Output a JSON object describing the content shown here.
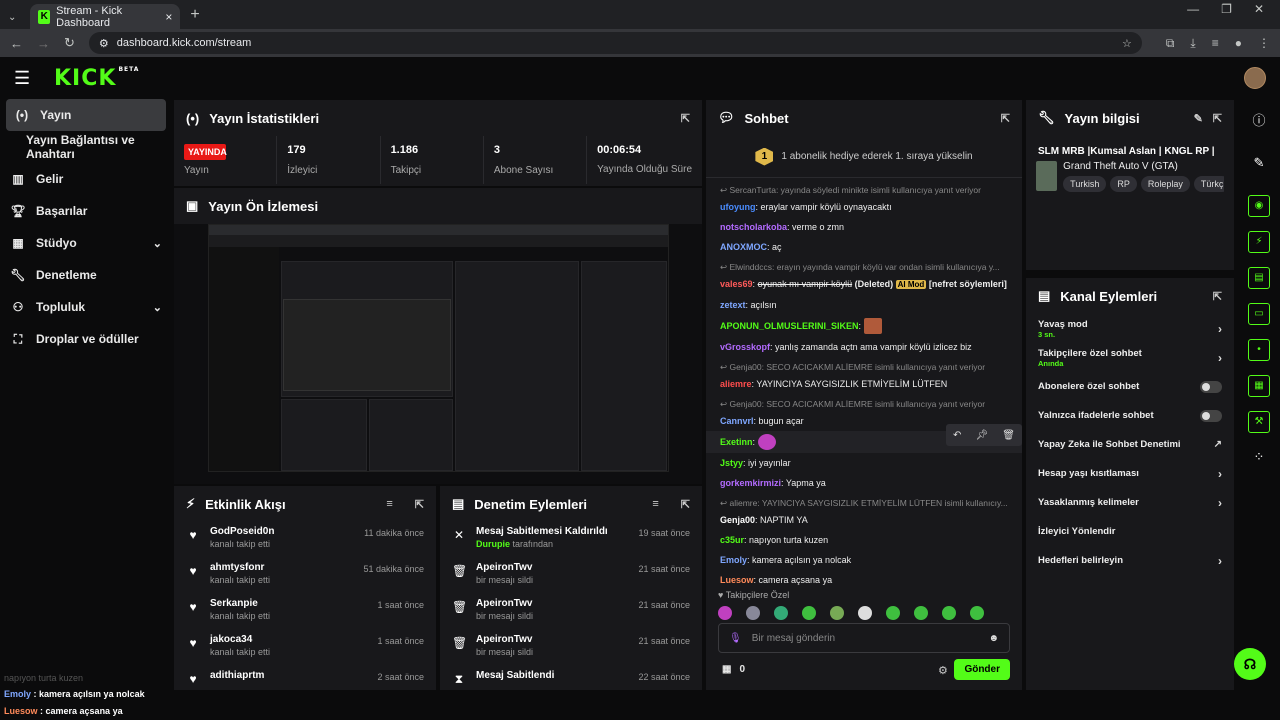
{
  "browser": {
    "tab_title": "Stream - Kick Dashboard",
    "url": "dashboard.kick.com/stream"
  },
  "brand": {
    "logo": "KICK",
    "beta": "BETA",
    "accent": "#53fc18"
  },
  "sidebar": {
    "items": [
      {
        "label": "Yayın",
        "icon": "broadcast-icon"
      },
      {
        "label": "Yayın Bağlantısı ve Anahtarı"
      },
      {
        "label": "Gelir",
        "icon": "chart-icon"
      },
      {
        "label": "Başarılar",
        "icon": "trophy-icon"
      },
      {
        "label": "Stüdyo",
        "icon": "studio-icon"
      },
      {
        "label": "Denetleme",
        "icon": "wrench-icon"
      },
      {
        "label": "Topluluk",
        "icon": "community-icon"
      },
      {
        "label": "Droplar ve ödüller",
        "icon": "gift-icon"
      }
    ]
  },
  "stats_panel": {
    "title": "Yayın İstatistikleri",
    "live_label": "YAYINDA",
    "live_caption": "Yayın",
    "stats": [
      {
        "value": "179",
        "label": "İzleyici"
      },
      {
        "value": "1.186",
        "label": "Takipçi"
      },
      {
        "value": "3",
        "label": "Abone Sayısı"
      },
      {
        "value": "00:06:54",
        "label": "Yayında Olduğu Süre"
      }
    ]
  },
  "preview_panel": {
    "title": "Yayın Ön İzlemesi"
  },
  "activity_panel": {
    "title": "Etkinlik Akışı",
    "items": [
      {
        "name": "GodPoseid0n",
        "sub": "kanalı takip etti",
        "time": "11 dakika önce"
      },
      {
        "name": "ahmtysfonr",
        "sub": "kanalı takip etti",
        "time": "51 dakika önce"
      },
      {
        "name": "Serkanpie",
        "sub": "kanalı takip etti",
        "time": "1 saat önce"
      },
      {
        "name": "jakoca34",
        "sub": "kanalı takip etti",
        "time": "1 saat önce"
      },
      {
        "name": "adithiaprtm",
        "sub": "",
        "time": "2 saat önce"
      }
    ]
  },
  "mod_panel": {
    "title": "Denetim Eylemleri",
    "items": [
      {
        "name": "Mesaj Sabitlemesi Kaldırıldı",
        "by": "Durupie",
        "sub": "tarafından",
        "time": "19 saat önce"
      },
      {
        "name": "ApeironTwv",
        "sub": "bir mesajı sildi",
        "time": "21 saat önce"
      },
      {
        "name": "ApeironTwv",
        "sub": "bir mesajı sildi",
        "time": "21 saat önce"
      },
      {
        "name": "ApeironTwv",
        "sub": "bir mesajı sildi",
        "time": "21 saat önce"
      },
      {
        "name": "Mesaj Sabitlendi",
        "sub": "",
        "time": "22 saat önce"
      }
    ]
  },
  "chat": {
    "title": "Sohbet",
    "banner": "1 abonelik hediye ederek 1. sıraya yükselin",
    "rank": "1",
    "messages": [
      {
        "reply": "SercanTurta: yayında söyledi minikte isimli kullanıcıya yanıt veriyor",
        "user": "ufoyung",
        "color": "#4a8cff",
        "text": "eraylar vampir köylü oynayacaktı"
      },
      {
        "user": "notscholarkoba",
        "color": "#b36bff",
        "text": "verme o zmn"
      },
      {
        "user": "ANOXMOC",
        "color": "#7fa7ff",
        "text": "aç"
      },
      {
        "reply": "Elwinddccs: erayın yayında vampir köylü var ondan isimli kullanıcıya y...",
        "user": "vales69",
        "color": "#ff5a5a",
        "text": "oyunak mı vampir köylü",
        "deleted": "(Deleted)",
        "mod": "AI Mod",
        "reason": "[nefret söylemleri]"
      },
      {
        "user": "zetext",
        "color": "#7fa7ff",
        "text": "açılsın"
      },
      {
        "user": "APONUN_OLMUSLERINI_SIKEN",
        "color": "#53fc18",
        "text": ""
      },
      {
        "user": "vGrosskopf",
        "color": "#b36bff",
        "text": "yanlış zamanda açtn ama vampir köylü izlicez biz"
      },
      {
        "reply": "Genja00: SECO ACICAKMI ALİEMRE isimli kullanıcıya yanıt veriyor",
        "user": "aliemre",
        "color": "#ff4d4d",
        "text": "YAYINCIYA SAYGISIZLIK ETMİYELİM LÜTFEN"
      },
      {
        "reply": "Genja00: SECO ACICAKMI ALİEMRE isimli kullanıcıya yanıt veriyor",
        "user": "Cannvrl",
        "color": "#7fa7ff",
        "text": "bugun açar"
      },
      {
        "user": "Exetinn",
        "color": "#53fc18",
        "text": ""
      },
      {
        "user": "Jstyy",
        "color": "#53fc18",
        "text": "iyi yayınlar"
      },
      {
        "user": "gorkemkirmizi",
        "color": "#b36bff",
        "text": "Yapma ya"
      },
      {
        "reply": "aliemre: YAYINCIYA SAYGISIZLIK ETMİYELİM LÜTFEN isimli kullanıcıy...",
        "user": "Genja00",
        "color": "#fff",
        "text": "NAPTIM YA"
      },
      {
        "user": "c35ur",
        "color": "#53fc18",
        "text": "napıyon turta kuzen"
      },
      {
        "user": "Emoly",
        "color": "#7fa7ff",
        "text": "kamera açılsın ya nolcak"
      },
      {
        "user": "Luesow",
        "color": "#ff8a5a",
        "text": "camera açsana ya"
      }
    ],
    "followers_only": "Takipçilere Özel",
    "input_placeholder": "Bir mesaj gönderin",
    "points": "0",
    "send_label": "Gönder"
  },
  "info_panel": {
    "title": "Yayın bilgisi",
    "stream_title": "SLM MRB |Kumsal Aslan | KNGL RP |",
    "category": "Grand Theft Auto V (GTA)",
    "tags": [
      "Turkish",
      "RP",
      "Roleplay",
      "Türkç"
    ]
  },
  "channel_actions": {
    "title": "Kanal Eylemleri",
    "items": [
      {
        "label": "Yavaş mod",
        "sub": "3 sn.",
        "control": "chevron"
      },
      {
        "label": "Takipçilere özel sohbet",
        "sub": "Anında",
        "control": "chevron"
      },
      {
        "label": "Abonelere özel sohbet",
        "control": "toggle"
      },
      {
        "label": "Yalnızca ifadelerle sohbet",
        "control": "toggle"
      },
      {
        "label": "Yapay Zeka ile Sohbet Denetimi",
        "control": "external"
      },
      {
        "label": "Hesap yaşı kısıtlaması",
        "control": "chevron"
      },
      {
        "label": "Yasaklanmış kelimeler",
        "control": "chevron"
      },
      {
        "label": "İzleyici Yönlendir",
        "control": "none"
      },
      {
        "label": "Hedefleri belirleyin",
        "control": "chevron"
      }
    ]
  },
  "overlay_chat": [
    {
      "user": "",
      "text": "napıyon turta kuzen"
    },
    {
      "user": "Emoly",
      "text": "kamera açılsın ya nolcak"
    },
    {
      "user": "Luesow",
      "text": "camera açsana ya"
    }
  ]
}
